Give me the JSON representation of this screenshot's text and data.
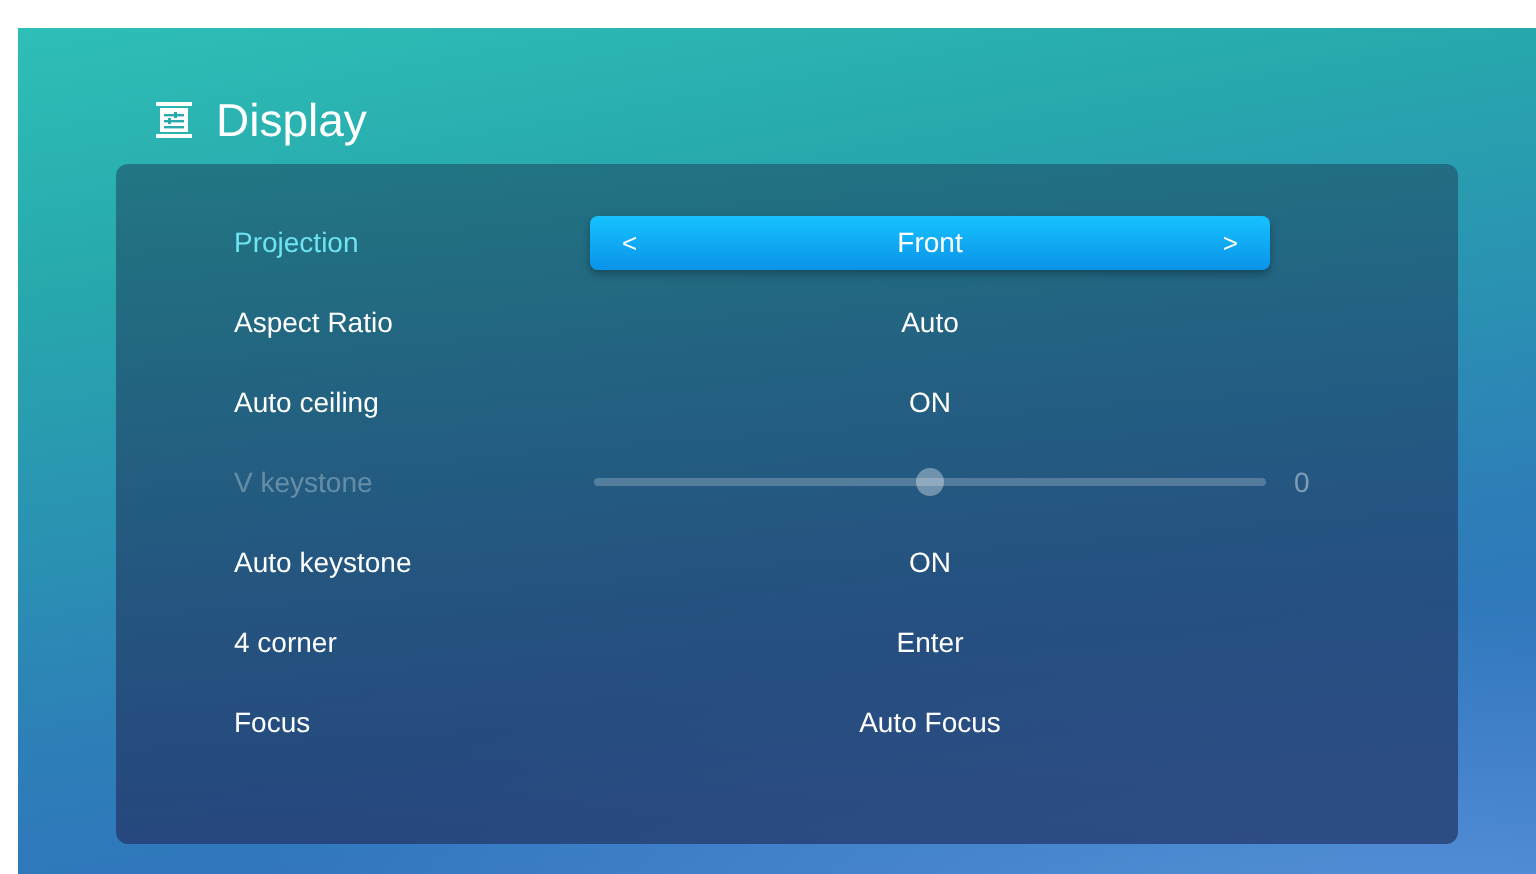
{
  "header": {
    "title": "Display"
  },
  "settings": [
    {
      "label": "Projection",
      "kind": "selector",
      "value": "Front",
      "prev": "<",
      "next": ">",
      "selected": true,
      "disabled": false
    },
    {
      "label": "Aspect Ratio",
      "kind": "value",
      "value": "Auto",
      "selected": false,
      "disabled": false
    },
    {
      "label": "Auto ceiling",
      "kind": "value",
      "value": "ON",
      "selected": false,
      "disabled": false
    },
    {
      "label": "V keystone",
      "kind": "slider",
      "level": 0.5,
      "reading": "0",
      "selected": false,
      "disabled": true
    },
    {
      "label": "Auto keystone",
      "kind": "value",
      "value": "ON",
      "selected": false,
      "disabled": false
    },
    {
      "label": "4 corner",
      "kind": "value",
      "value": "Enter",
      "selected": false,
      "disabled": false
    },
    {
      "label": "Focus",
      "kind": "value",
      "value": "Auto Focus",
      "selected": false,
      "disabled": false
    }
  ]
}
